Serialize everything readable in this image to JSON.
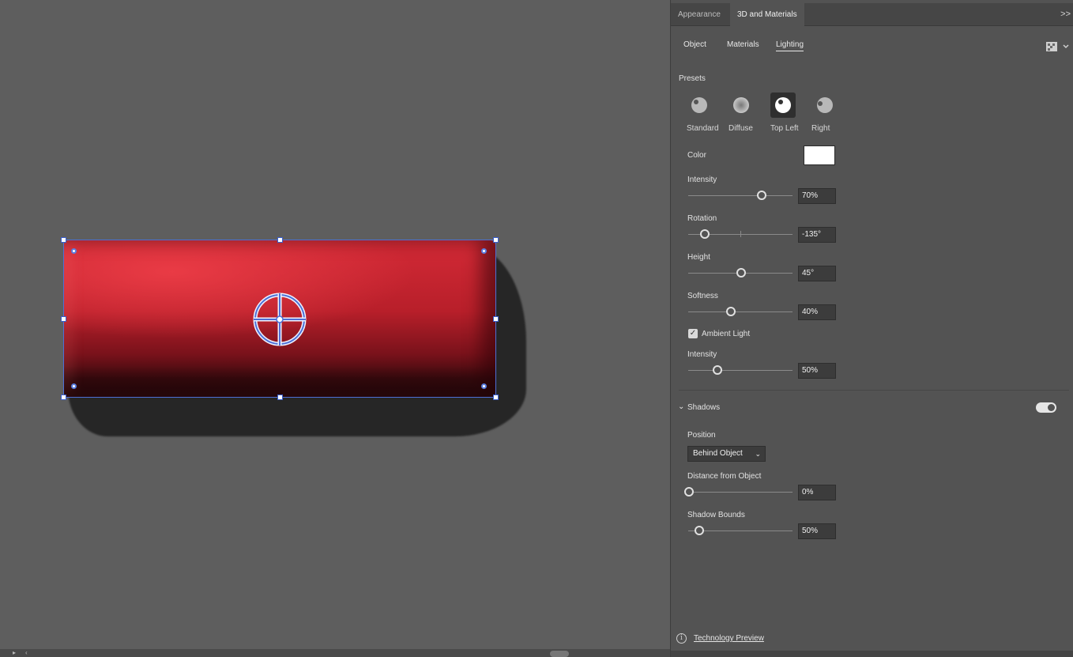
{
  "panel": {
    "tabs": [
      {
        "label": "Appearance"
      },
      {
        "label": "3D and Materials"
      }
    ],
    "expand_icon": "double-chevron-right-icon",
    "subtabs": [
      {
        "label": "Object"
      },
      {
        "label": "Materials"
      },
      {
        "label": "Lighting"
      }
    ],
    "active_subtab": "Lighting",
    "render_icon": "render-settings-icon",
    "presets": {
      "label": "Presets",
      "items": [
        {
          "label": "Standard"
        },
        {
          "label": "Diffuse"
        },
        {
          "label": "Top Left"
        },
        {
          "label": "Right"
        }
      ],
      "selected": "Top Left"
    },
    "color": {
      "label": "Color",
      "value": "#ffffff"
    },
    "intensity": {
      "label": "Intensity",
      "value": "70%",
      "fraction": 0.7
    },
    "rotation": {
      "label": "Rotation",
      "value": "-135°",
      "fraction": 0.15
    },
    "height": {
      "label": "Height",
      "value": "45°",
      "fraction": 0.5
    },
    "softness": {
      "label": "Softness",
      "value": "40%",
      "fraction": 0.4
    },
    "ambient_light": {
      "label": "Ambient Light",
      "checked": true
    },
    "ambient_intensity": {
      "label": "Intensity",
      "value": "50%",
      "fraction": 0.27
    },
    "shadows": {
      "label": "Shadows",
      "enabled": true
    },
    "position": {
      "label": "Position",
      "value": "Behind Object"
    },
    "distance": {
      "label": "Distance from Object",
      "value": "0%",
      "fraction": 0.0
    },
    "shadow_bounds": {
      "label": "Shadow Bounds",
      "value": "50%",
      "fraction": 0.1
    },
    "technology_preview": "Technology Preview"
  },
  "colors": {
    "object_red": "#c8232f",
    "selection_blue": "#4d6fd6",
    "panel_bg": "#535353",
    "canvas_bg": "#5e5e5e"
  }
}
